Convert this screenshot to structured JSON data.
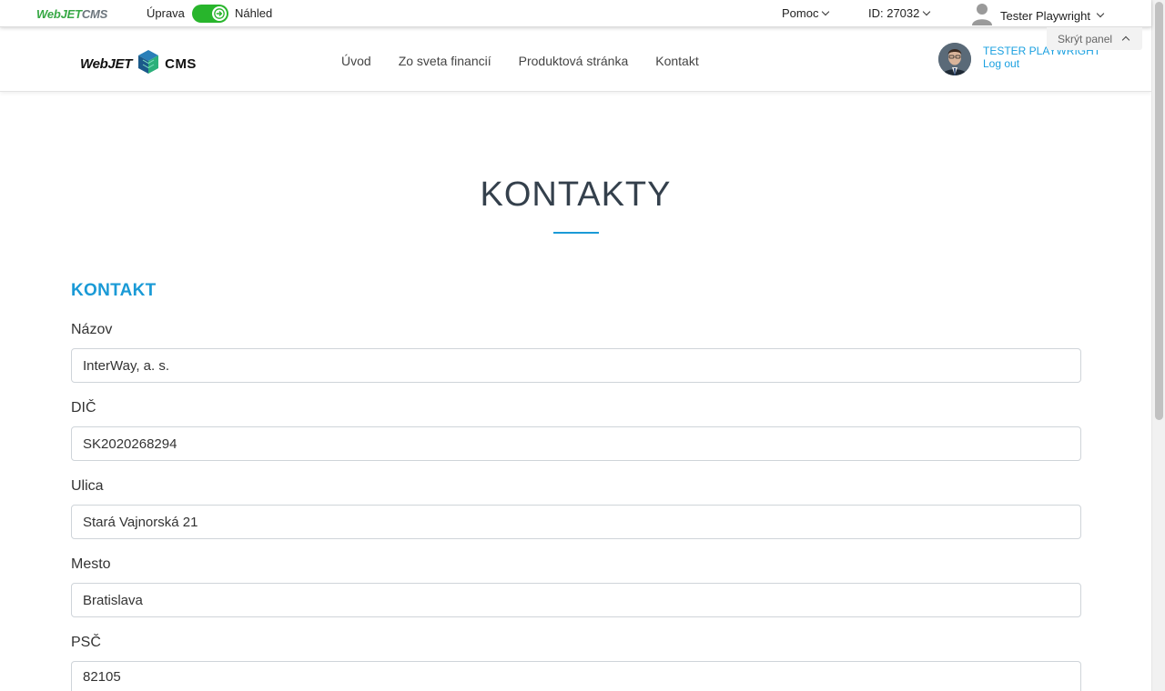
{
  "adminbar": {
    "logo_part1": "WebJET",
    "logo_part2": "CMS",
    "edit_label": "Úprava",
    "preview_label": "Náhled",
    "help_label": "Pomoc",
    "id_label": "ID: 27032",
    "user_label": "Tester Playwright",
    "hide_panel_label": "Skrýt panel"
  },
  "site": {
    "logo_part1": "WebJET",
    "logo_part2": "CMS",
    "nav": [
      {
        "label": "Úvod"
      },
      {
        "label": "Zo sveta financií"
      },
      {
        "label": "Produktová stránka"
      },
      {
        "label": "Kontakt"
      }
    ],
    "profile_name": "TESTER PLAYWRIGHT",
    "logout_label": "Log out"
  },
  "main": {
    "page_title": "KONTAKTY",
    "section_title": "KONTAKT",
    "fields": [
      {
        "label": "Názov",
        "value": "InterWay, a. s."
      },
      {
        "label": "DIČ",
        "value": "SK2020268294"
      },
      {
        "label": "Ulica",
        "value": "Stará Vajnorská 21"
      },
      {
        "label": "Mesto",
        "value": "Bratislava"
      },
      {
        "label": "PSČ",
        "value": "82105"
      }
    ]
  },
  "colors": {
    "toggle_green": "#28b52c",
    "accent_blue": "#1a9ad6",
    "title_dark": "#34404c"
  }
}
